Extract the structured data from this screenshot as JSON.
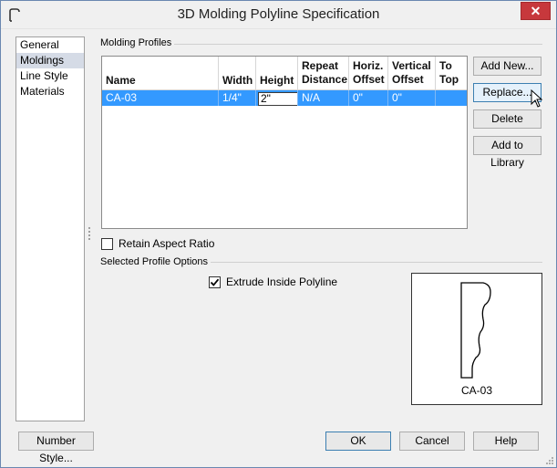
{
  "window": {
    "title": "3D Molding Polyline Specification",
    "close_glyph": "✕"
  },
  "nav": {
    "items": [
      {
        "label": "General",
        "selected": false
      },
      {
        "label": "Moldings",
        "selected": true
      },
      {
        "label": "Line Style",
        "selected": false
      },
      {
        "label": "Materials",
        "selected": false
      }
    ]
  },
  "molding_profiles": {
    "group_label": "Molding Profiles",
    "columns": [
      {
        "label": "Name"
      },
      {
        "label": "Width"
      },
      {
        "label": "Height"
      },
      {
        "label": "Repeat\nDistance"
      },
      {
        "label": "Horiz.\nOffset"
      },
      {
        "label": "Vertical\nOffset"
      },
      {
        "label": "To\nTop"
      }
    ],
    "rows": [
      {
        "name": "CA-03",
        "width": "1/4\"",
        "height": "2\"",
        "repeat_distance": "N/A",
        "horiz_offset": "0\"",
        "vertical_offset": "0\"",
        "to_top": ""
      }
    ],
    "selection_color": "#3399ff"
  },
  "side_buttons": {
    "add_new": "Add New...",
    "replace": "Replace...",
    "delete": "Delete",
    "add_to_library": "Add to Library"
  },
  "retain_aspect_ratio": {
    "label": "Retain Aspect Ratio",
    "checked": false
  },
  "selected_profile_options": {
    "group_label": "Selected Profile Options",
    "extrude_inside_polyline": {
      "label": "Extrude Inside Polyline",
      "checked": true
    },
    "preview_label": "CA-03"
  },
  "footer": {
    "number_style": "Number Style...",
    "ok": "OK",
    "cancel": "Cancel",
    "help": "Help"
  }
}
